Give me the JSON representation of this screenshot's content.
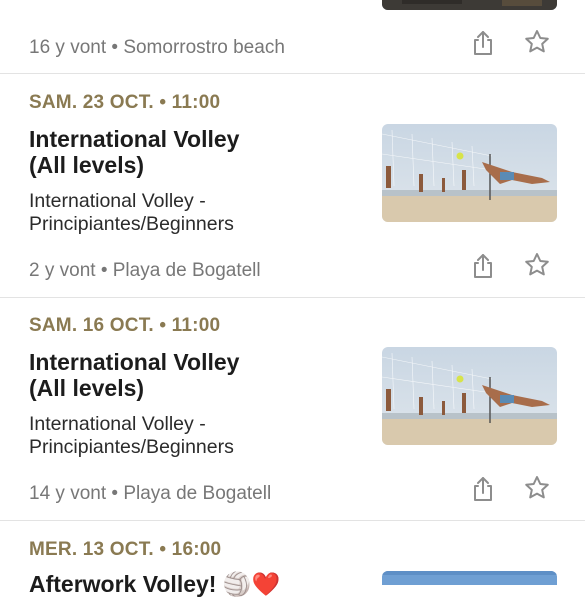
{
  "events": [
    {
      "meta": "16 y vont • Somorrostro beach"
    },
    {
      "date": "SAM. 23 OCT. • 11:00",
      "title_line1": "International Volley",
      "title_line2": "(All levels)",
      "desc_line1": "International Volley -",
      "desc_line2": "Principiantes/Beginners",
      "meta": "2 y vont • Playa de Bogatell"
    },
    {
      "date": "SAM. 16 OCT. • 11:00",
      "title_line1": "International Volley",
      "title_line2": "(All levels)",
      "desc_line1": "International Volley -",
      "desc_line2": "Principiantes/Beginners",
      "meta": "14 y vont • Playa de Bogatell"
    },
    {
      "date": "MER. 13 OCT. • 16:00",
      "title_partial": "Afterwork Volley! 🏐❤️"
    }
  ],
  "icons": {
    "share": "share-icon",
    "save": "star-icon"
  },
  "colors": {
    "date": "#8a7a52",
    "meta": "#777777",
    "title": "#1c1c1c"
  }
}
